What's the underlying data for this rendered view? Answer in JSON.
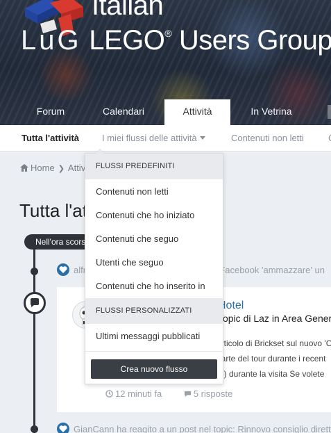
{
  "site": {
    "logo_line1": "Italian",
    "logo_line2_lug": "LuG",
    "logo_line2_rest": "LEGO",
    "logo_registered": "®",
    "logo_line2_tail": " Users Group"
  },
  "nav": {
    "tabs": [
      {
        "label": "Forum"
      },
      {
        "label": "Calendari"
      },
      {
        "label": "Attività"
      },
      {
        "label": "In Vetrina"
      }
    ],
    "active_tab": "Attività"
  },
  "subnav": {
    "items": [
      {
        "label": "Tutta l'attività"
      },
      {
        "label": "I miei flussi delle attività"
      },
      {
        "label": "Contenuti non letti"
      },
      {
        "label": "C"
      }
    ]
  },
  "breadcrumb": {
    "home": "Home",
    "current": "Attività"
  },
  "page_title": "Tutta l'attività",
  "timeline": {
    "time_label": "Nell'ora scorsa",
    "reaction1": "alfred ha reagito a un post nel topic: Facebook 'ammazzare' un",
    "reaction2": "GianCann ha reagito a un post nel topic: Rinnovo consiglio diretti",
    "card": {
      "title": "Hotel",
      "subtitle": "Topic di Laz in Area Generale",
      "line1": "articolo di Brickset sul nuovo 'C",
      "line2": "parte del tour durante i recent",
      "line3": "(e) durante la visita Se volete",
      "time": "12 minuti fa",
      "replies": "5 risposte"
    }
  },
  "dropdown": {
    "section1": "FLUSSI PREDEFINITI",
    "items1": [
      "Contenuti non letti",
      "Contenuti che ho iniziato",
      "Contenuti che seguo",
      "Utenti che seguo",
      "Contenuti che ho inserito in"
    ],
    "section2": "FLUSSI PERSONALIZZATI",
    "items2": [
      "Ultimi messaggi pubblicati"
    ],
    "button": "Crea nuovo flusso"
  },
  "colors": {
    "accent": "#2a6fa8",
    "dark": "#2f3238",
    "button": "#3a3e45"
  }
}
